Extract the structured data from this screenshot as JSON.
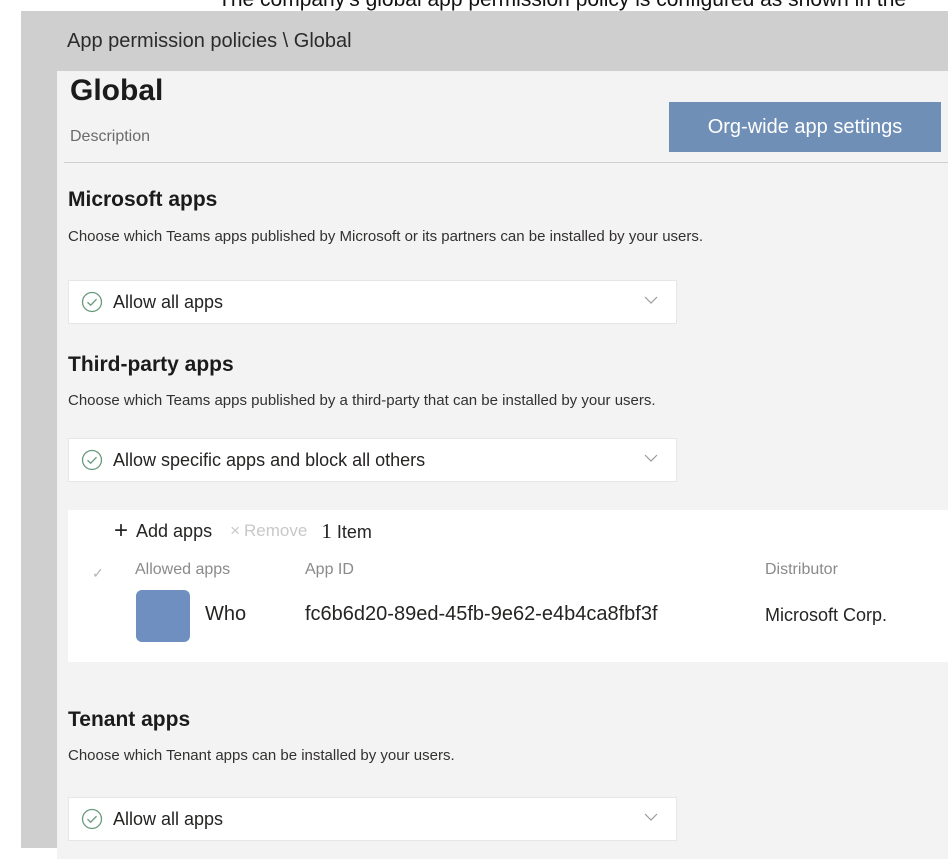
{
  "caption": "The company's global app permission policy is configured as shown in the",
  "window": {
    "title": "App permission policies \\ Global"
  },
  "header": {
    "title": "Global",
    "description": "Description",
    "org_button": "Org-wide app settings"
  },
  "sections": {
    "microsoft": {
      "title": "Microsoft apps",
      "description": "Choose which Teams apps published by Microsoft or its partners can be installed by your users.",
      "dropdown_value": "Allow all apps"
    },
    "third_party": {
      "title": "Third-party apps",
      "description": "Choose which Teams apps published by a third-party that can be installed by your users.",
      "dropdown_value": "Allow specific apps and block all others"
    },
    "tenant": {
      "title": "Tenant apps",
      "description": "Choose which Tenant apps can be installed by your users.",
      "dropdown_value": "Allow all apps"
    }
  },
  "apps_table": {
    "add_label": "Add apps",
    "remove_label": "Remove",
    "count": "1",
    "count_label": "Item",
    "columns": [
      "Allowed apps",
      "App ID",
      "Distributor"
    ],
    "rows": [
      {
        "name": "Who",
        "app_id": "fc6b6d20-89ed-45fb-9e62-e4b4ca8fbf3f",
        "distributor": "Microsoft Corp."
      }
    ]
  },
  "colors": {
    "accent_button": "#6f8fb7",
    "app_tile": "#6f8fc1",
    "check_icon": "#6a9a7e"
  }
}
